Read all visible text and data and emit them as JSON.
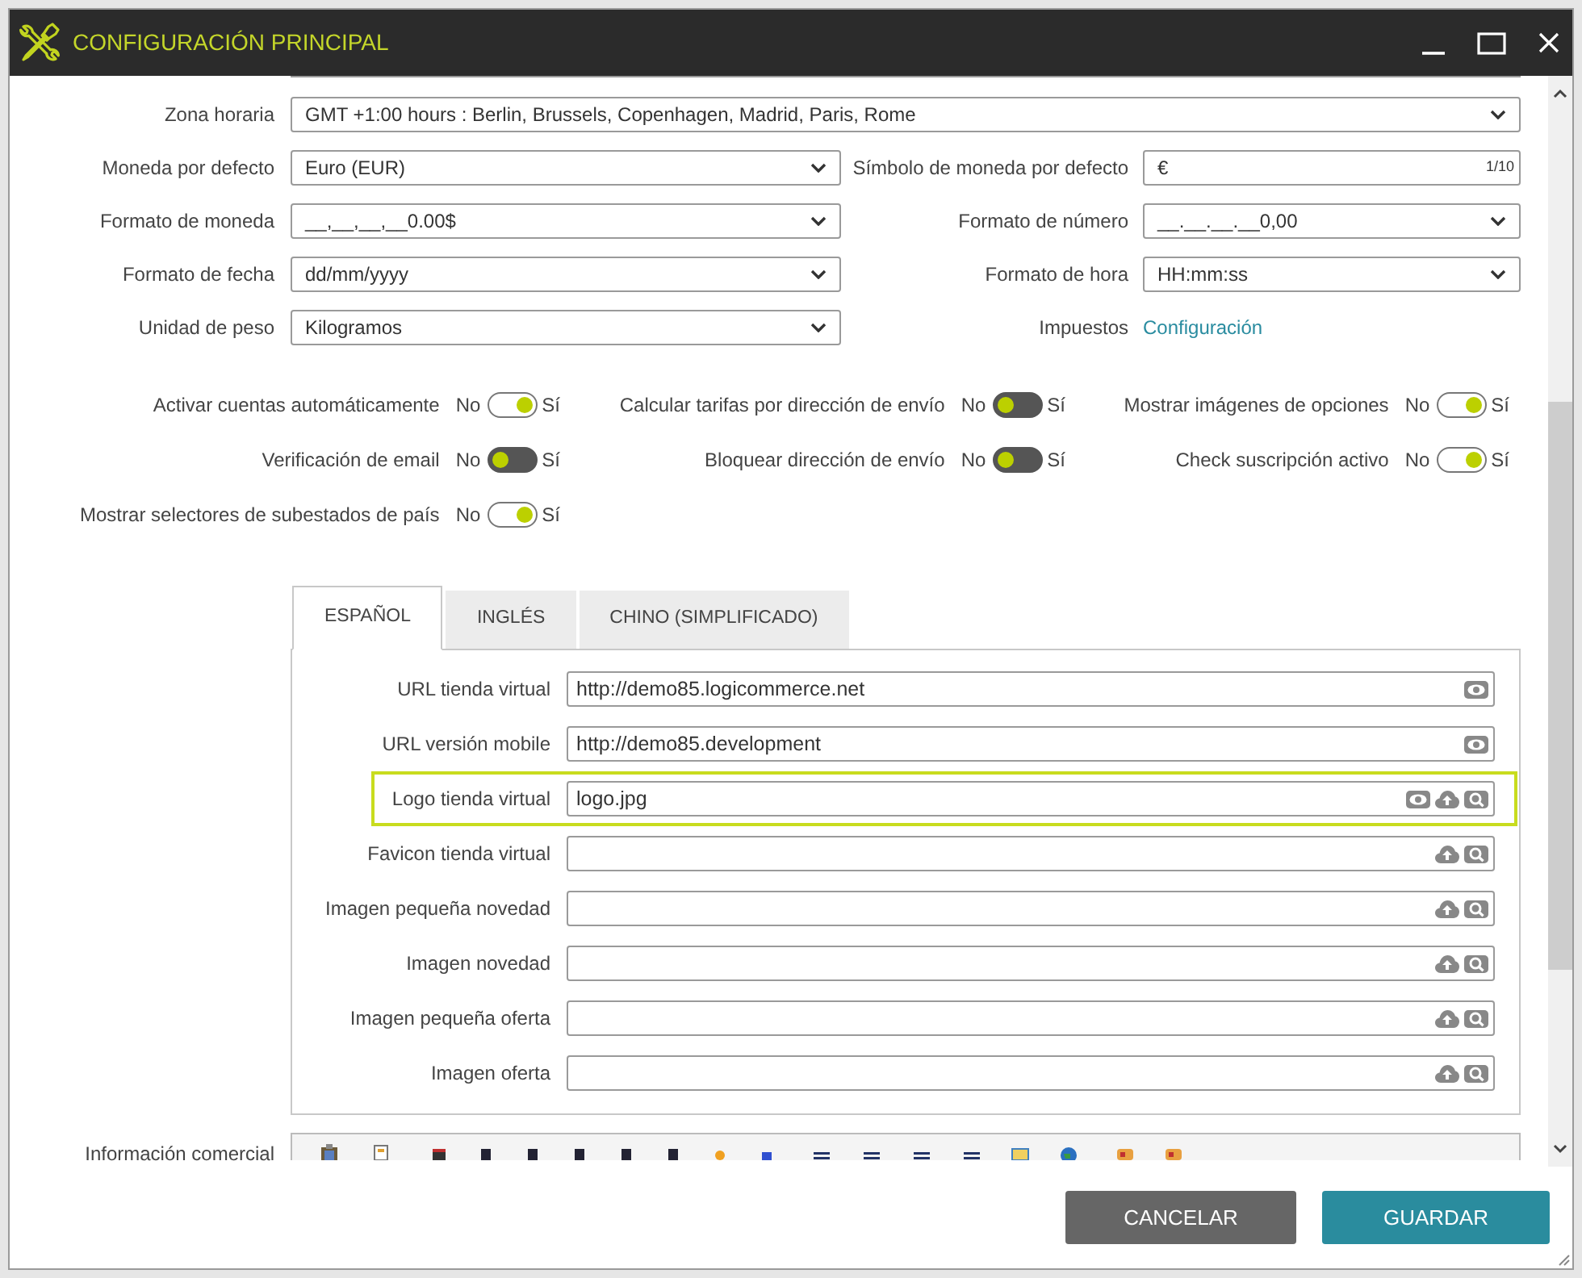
{
  "window": {
    "title": "CONFIGURACIÓN PRINCIPAL"
  },
  "timezone": {
    "label": "Zona horaria",
    "value": "GMT +1:00 hours : Berlin, Brussels, Copenhagen, Madrid, Paris, Rome"
  },
  "form_rows": [
    {
      "left": {
        "kind": "select",
        "label": "Moneda por defecto",
        "value": "Euro (EUR)"
      },
      "right": {
        "kind": "text",
        "label": "Símbolo de moneda por defecto",
        "value": "€",
        "counter": "1/10"
      }
    },
    {
      "left": {
        "kind": "select",
        "label": "Formato de moneda",
        "value": "__,__,__,__0.00$"
      },
      "right": {
        "kind": "select",
        "label": "Formato de número",
        "value": "__.__.__.__0,00"
      }
    },
    {
      "left": {
        "kind": "select",
        "label": "Formato de fecha",
        "value": "dd/mm/yyyy"
      },
      "right": {
        "kind": "select",
        "label": "Formato de hora",
        "value": "HH:mm:ss"
      }
    },
    {
      "left": {
        "kind": "select",
        "label": "Unidad de peso",
        "value": "Kilogramos"
      },
      "right": {
        "kind": "link",
        "label": "Impuestos",
        "value": "Configuración"
      }
    }
  ],
  "switches": [
    {
      "label": "Activar cuentas automáticamente",
      "off_label": "No",
      "on_label": "Sí",
      "on": true
    },
    {
      "label": "Calcular tarifas por dirección de envío",
      "off_label": "No",
      "on_label": "Sí",
      "on": false
    },
    {
      "label": "Mostrar imágenes de opciones",
      "off_label": "No",
      "on_label": "Sí",
      "on": true
    },
    {
      "label": "Verificación de email",
      "off_label": "No",
      "on_label": "Sí",
      "on": false
    },
    {
      "label": "Bloquear dirección de envío",
      "off_label": "No",
      "on_label": "Sí",
      "on": false
    },
    {
      "label": "Check suscripción activo",
      "off_label": "No",
      "on_label": "Sí",
      "on": true
    },
    {
      "label": "Mostrar selectores de subestados de país",
      "off_label": "No",
      "on_label": "Sí",
      "on": true
    }
  ],
  "language_tabs": [
    {
      "label": "ESPAÑOL",
      "selected": true
    },
    {
      "label": "INGLÉS",
      "selected": false
    },
    {
      "label": "CHINO (SIMPLIFICADO)",
      "selected": false
    }
  ],
  "tab_fields": [
    {
      "kind": "url",
      "label": "URL tienda virtual",
      "value": "http://demo85.logicommerce.net",
      "highlighted": false
    },
    {
      "kind": "url",
      "label": "URL versión mobile",
      "value": "http://demo85.development",
      "highlighted": false
    },
    {
      "kind": "image",
      "label": "Logo tienda virtual",
      "value": "logo.jpg",
      "highlighted": true
    },
    {
      "kind": "image",
      "label": "Favicon tienda virtual",
      "highlighted": false
    },
    {
      "kind": "image",
      "label": "Imagen pequeña novedad",
      "highlighted": false
    },
    {
      "kind": "image",
      "label": "Imagen novedad",
      "highlighted": false
    },
    {
      "kind": "image",
      "label": "Imagen pequeña oferta",
      "highlighted": false
    },
    {
      "kind": "image",
      "label": "Imagen oferta",
      "highlighted": false
    }
  ],
  "commercial_info": {
    "label": "Información comercial"
  },
  "buttons": [
    {
      "kind": "cancel",
      "label": "CANCELAR"
    },
    {
      "kind": "save",
      "label": "GUARDAR"
    }
  ]
}
